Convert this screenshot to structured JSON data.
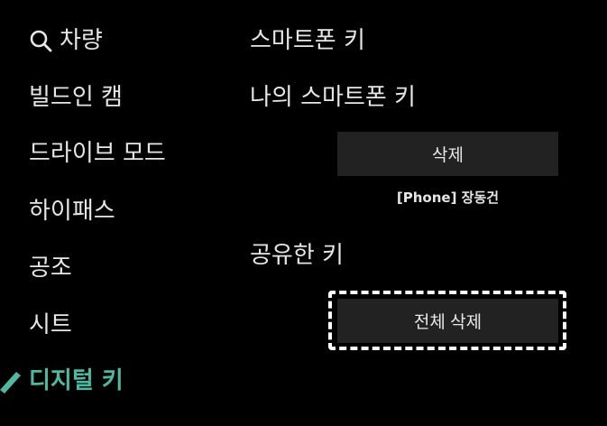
{
  "sidebar": {
    "items": [
      {
        "label": "차량",
        "icon": "search-icon"
      },
      {
        "label": "빌드인 캠"
      },
      {
        "label": "드라이브 모드"
      },
      {
        "label": "하이패스"
      },
      {
        "label": "공조"
      },
      {
        "label": "시트"
      },
      {
        "label": "디지털 키",
        "active": true
      }
    ]
  },
  "content": {
    "smartphone_key_title": "스마트폰 키",
    "my_smartphone_key_title": "나의 스마트폰 키",
    "delete_button": "삭제",
    "device_label": "[Phone] 장동건",
    "shared_key_title": "공유한 키",
    "delete_all_button": "전체 삭제"
  },
  "colors": {
    "background": "#000000",
    "accent": "#4fb8a0",
    "button_bg": "#222222",
    "text": "#e6e6e6"
  }
}
